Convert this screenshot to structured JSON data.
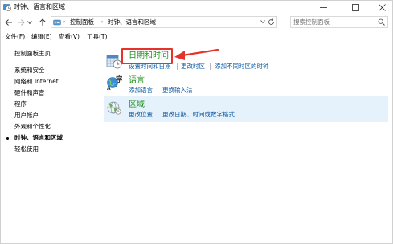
{
  "window": {
    "title": "时钟、语言和区域"
  },
  "address": {
    "crumbs": [
      "控制面板",
      "时钟、语言和区域"
    ],
    "search_placeholder": "搜索控制面板"
  },
  "menu": {
    "items": [
      "文件(F)",
      "编辑(E)",
      "查看(V)",
      "工具(T)"
    ]
  },
  "sidebar": {
    "home": "控制面板主页",
    "items": [
      "系统和安全",
      "网络和 Internet",
      "硬件和声音",
      "程序",
      "用户帐户",
      "外观和个性化",
      "时钟、语言和区域",
      "轻松使用"
    ],
    "current_index": 6
  },
  "categories": [
    {
      "title": "日期和时间",
      "links": [
        "设置时间和日期",
        "更改时区",
        "添加不同时区的时钟"
      ],
      "icon": "clock-calendar-icon"
    },
    {
      "title": "语言",
      "links": [
        "添加语言",
        "更换输入法"
      ],
      "icon": "language-icon"
    },
    {
      "title": "区域",
      "links": [
        "更改位置",
        "更改日期、时间或数字格式"
      ],
      "icon": "region-globe-icon"
    }
  ],
  "colors": {
    "title_green": "#1e8f1e",
    "link_blue": "#0a58a0",
    "annotation_red": "#e5332a",
    "hover_bg": "#e5f1fb"
  }
}
